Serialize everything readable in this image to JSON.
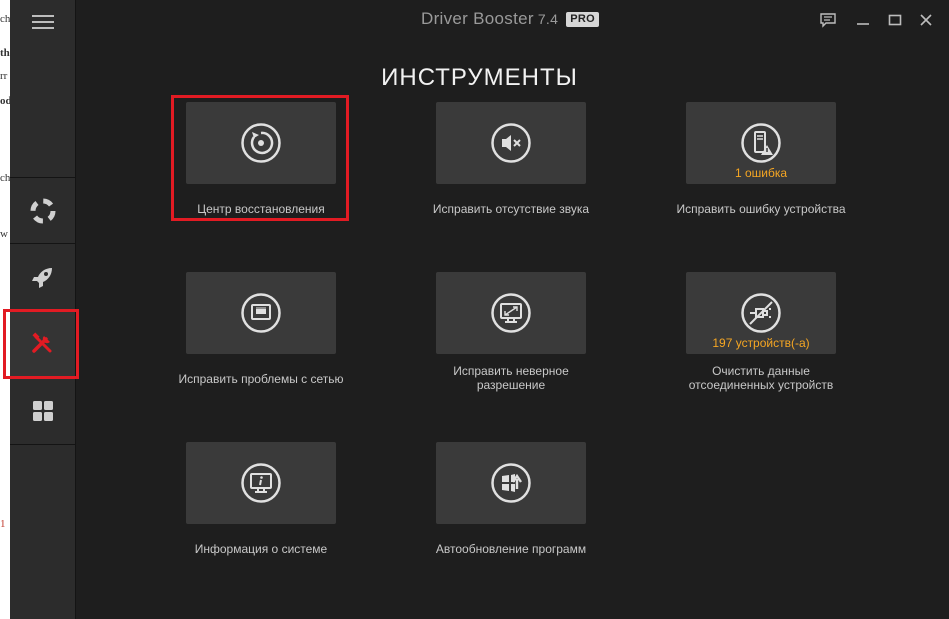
{
  "background_window": {
    "fragments": [
      "ch",
      "th",
      "rr",
      "od",
      "ch",
      "w",
      "1"
    ]
  },
  "app": {
    "title": "Driver Booster",
    "version": "7.4",
    "edition_badge": "PRO"
  },
  "sidebar": {
    "items": [
      {
        "name": "lifebuoy-icon",
        "active": false
      },
      {
        "name": "rocket-icon",
        "active": false
      },
      {
        "name": "tools-icon",
        "active": true
      },
      {
        "name": "apps-grid-icon",
        "active": false
      }
    ]
  },
  "main": {
    "heading": "ИНСТРУМЕНТЫ",
    "tools": [
      {
        "label": "Центр восстановления",
        "badge": "",
        "icon": "restore-icon"
      },
      {
        "label": "Исправить отсутствие звука",
        "badge": "",
        "icon": "mute-speaker-icon"
      },
      {
        "label": "Исправить ошибку устройства",
        "badge": "1 ошибка",
        "icon": "device-warning-icon"
      },
      {
        "label": "Исправить проблемы с сетью",
        "badge": "",
        "icon": "network-icon"
      },
      {
        "label_line1": "Исправить неверное",
        "label_line2": "разрешение",
        "badge": "",
        "icon": "resolution-icon"
      },
      {
        "label_line1": "Очистить данные",
        "label_line2": "отсоединенных устройств",
        "badge": "197 устройств(-а)",
        "icon": "disconnected-device-icon"
      },
      {
        "label": "Информация о системе",
        "badge": "",
        "icon": "system-info-icon"
      },
      {
        "label": "Автообновление программ",
        "badge": "",
        "icon": "app-update-icon"
      }
    ]
  },
  "colors": {
    "background": "#1e1e1e",
    "sidebar": "#2c2c2c",
    "tile": "#3a3a3a",
    "accent_red": "#e21b23",
    "badge_orange": "#f5a623"
  }
}
